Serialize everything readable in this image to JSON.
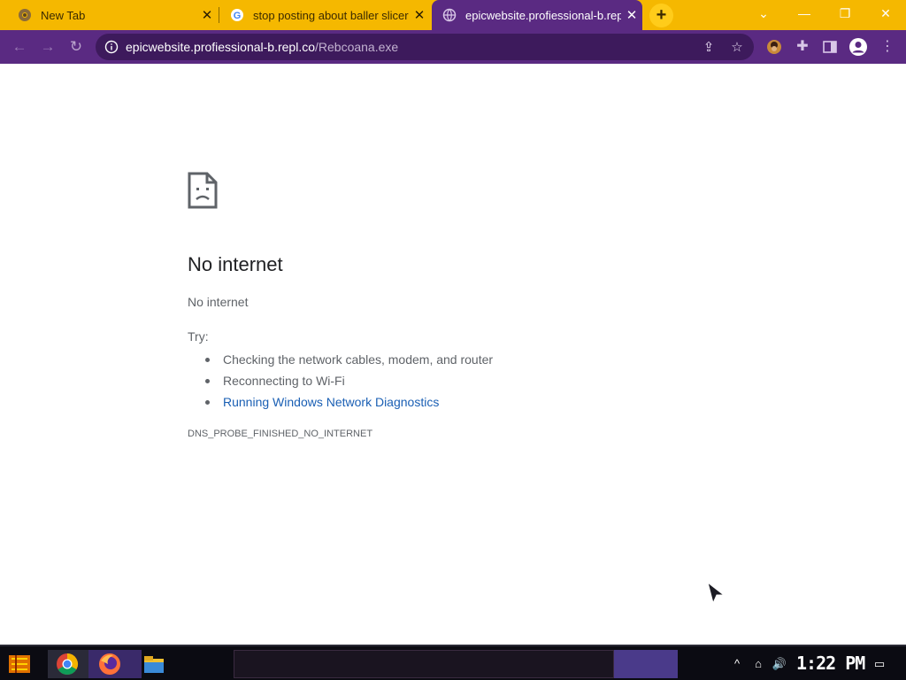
{
  "browser": {
    "tabs": [
      {
        "title": "New Tab",
        "favicon": "chrome-icon",
        "active": false
      },
      {
        "title": "stop posting about baller slicer",
        "favicon": "google-icon",
        "active": false
      },
      {
        "title": "epicwebsite.profiessional-b.repl",
        "favicon": "globe-icon",
        "active": true
      }
    ],
    "new_tab_label": "+",
    "address": {
      "host": "epicwebsite.profiessional-b.repl.co",
      "path": "/Rebcoana.exe"
    },
    "colors": {
      "tab_strip": "#f5b800",
      "toolbar": "#5a2a82",
      "omnibox": "#3d1a5c"
    }
  },
  "error_page": {
    "icon": "sad-page-icon",
    "heading": "No internet",
    "subheading": "No internet",
    "try_label": "Try:",
    "suggestions": [
      "Checking the network cables, modem, and router",
      "Reconnecting to Wi-Fi",
      "Running Windows Network Diagnostics"
    ],
    "error_code": "DNS_PROBE_FINISHED_NO_INTERNET"
  },
  "taskbar": {
    "apps": [
      "start-icon",
      "chrome-icon",
      "firefox-icon",
      "file-explorer-icon"
    ],
    "time": "1:22 PM"
  }
}
